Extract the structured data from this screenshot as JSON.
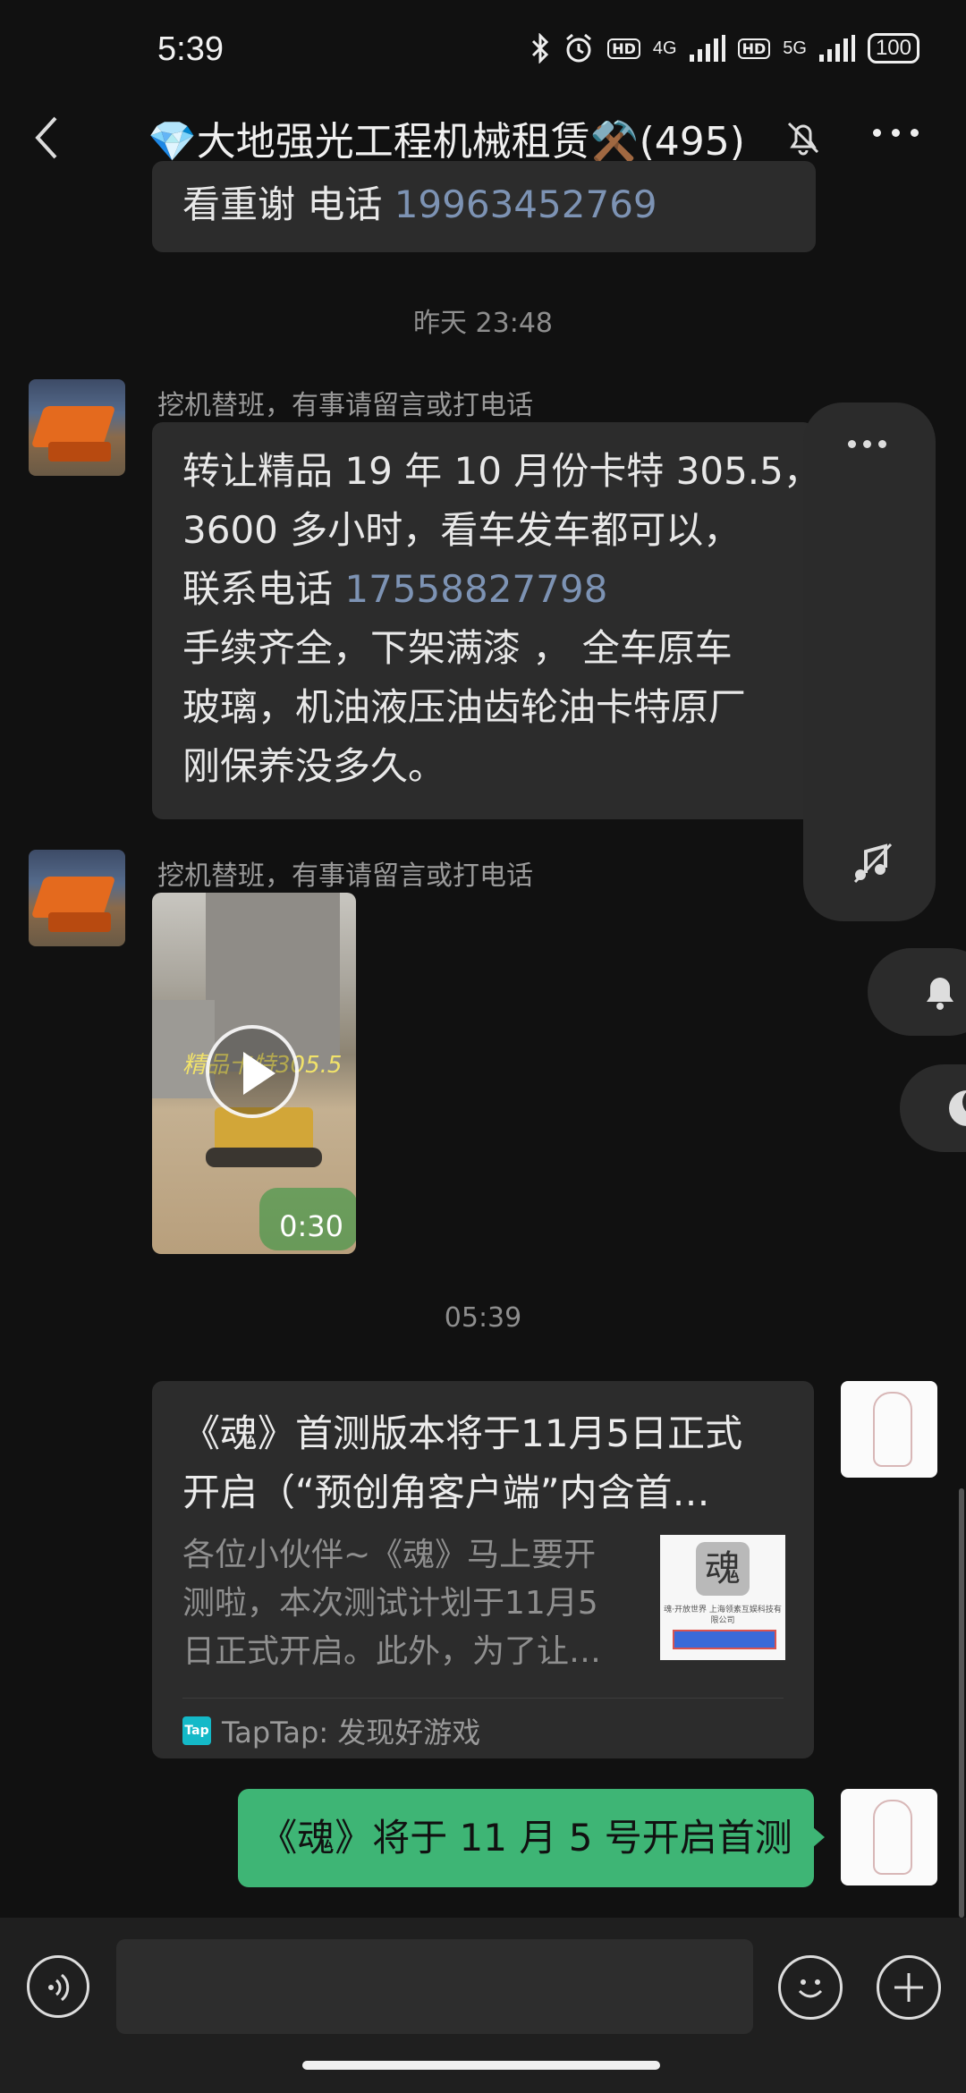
{
  "status_bar": {
    "time": "5:39",
    "sim1_label": "4G",
    "sim2_label": "5G",
    "hd_label": "HD",
    "battery": "100"
  },
  "header": {
    "title": "💎大地强光工程机械租赁⚒️(495)",
    "icons": [
      "back-arrow-icon",
      "bell-off-icon",
      "more-dots-icon"
    ]
  },
  "messages": {
    "previous_fragment": {
      "prefix": "看重谢 电话 ",
      "phone": "19963452769"
    },
    "timestamp_1": "昨天 23:48",
    "msg1": {
      "sender": "挖机替班，有事请留言或打电话",
      "line1": "转让精品 19 年 10 月份卡特 305.5，",
      "line2": "3600 多小时，看车发车都可以，",
      "line3_prefix": "联系电话 ",
      "line3_phone": "17558827798",
      "line4": "手续齐全，下架满漆 ， 全车原车",
      "line5": "玻璃，机油液压油齿轮油卡特原厂",
      "line6": "刚保养没多久。"
    },
    "msg2": {
      "sender": "挖机替班，有事请留言或打电话",
      "video_caption": "精品卡特305.5",
      "video_duration": "0:30"
    },
    "timestamp_2": "05:39",
    "card": {
      "title_line1": "《魂》首测版本将于11月5日正式",
      "title_line2": "开启（“预创角客户端”内含首…",
      "desc_line1": "各位小伙伴~《魂》马上要开",
      "desc_line2": "测啦，本次测试计划于11月5",
      "desc_line3": "日正式开启。此外，为了让…",
      "thumb_glyph": "魂",
      "thumb_text": "魂·开放世界 上海领素互娱科技有限公司",
      "source_logo": "Tap",
      "source": "TapTap: 发现好游戏"
    },
    "outgoing": "《魂》将于 11 月 5 号开启首测"
  },
  "colors": {
    "background": "#111111",
    "bubble_in": "#2c2c2c",
    "bubble_out": "#3eb575",
    "link": "#7d93b4"
  }
}
